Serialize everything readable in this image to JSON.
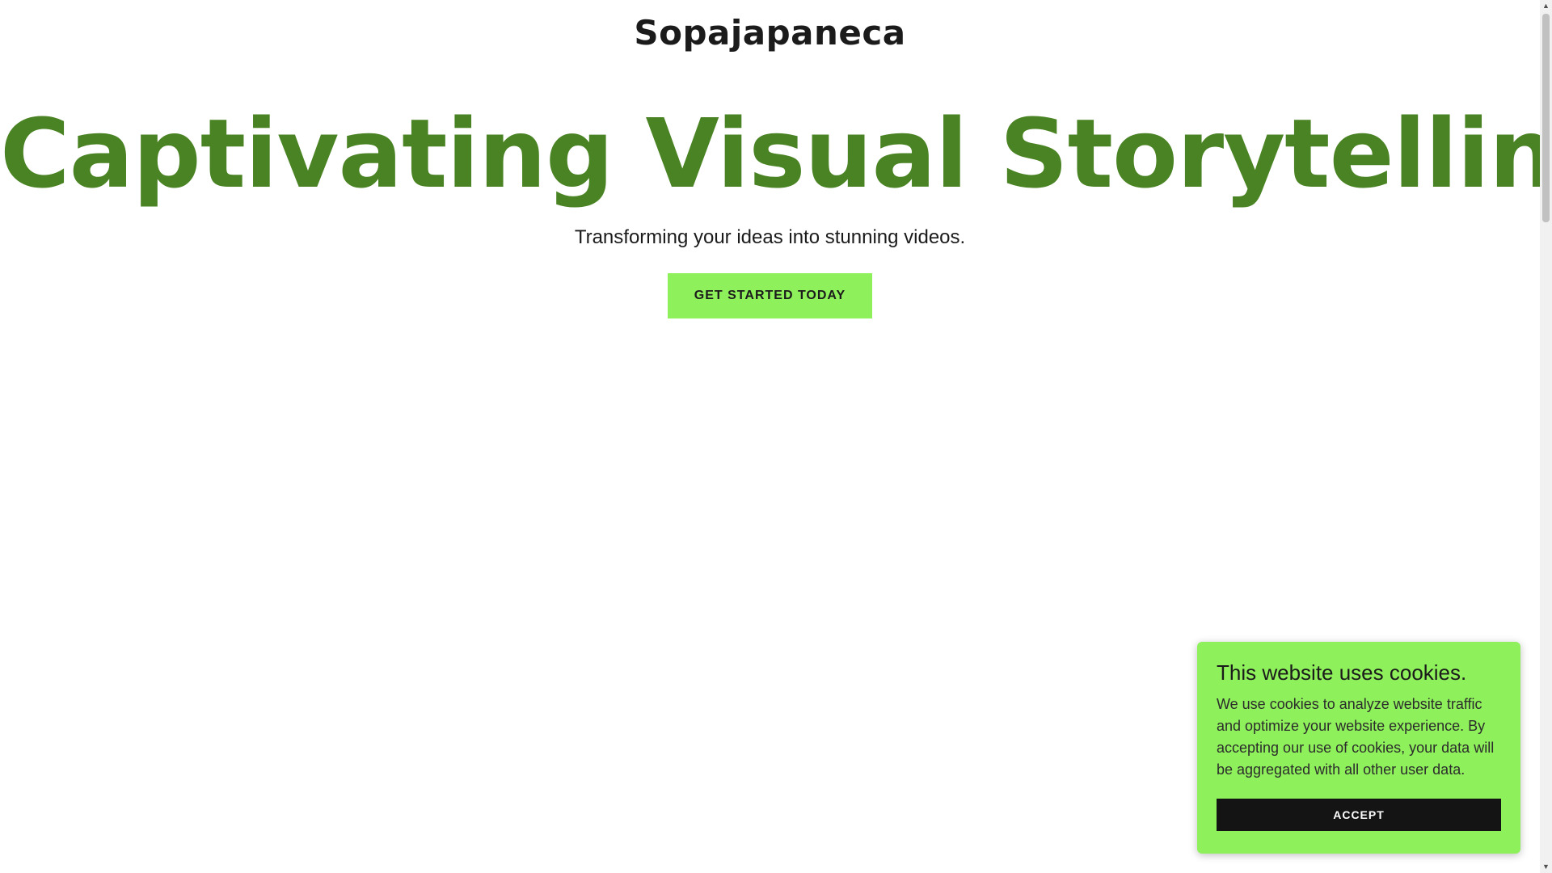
{
  "header": {
    "brand": "Sopajapaneca"
  },
  "hero": {
    "title": "Captivating Visual Storytelling",
    "subtitle": "Transforming your ideas into stunning videos.",
    "cta_label": "GET STARTED TODAY"
  },
  "cookie_banner": {
    "title": "This website uses cookies.",
    "text": "We use cookies to analyze website traffic and optimize your website experience. By accepting our use of cookies, your data will be aggregated with all other user data.",
    "accept_label": "ACCEPT"
  },
  "scrollbar": {
    "up_icon": "▲",
    "down_icon": "▼"
  },
  "colors": {
    "accent": "#8ef05b",
    "title": "#4a8323",
    "text": "#1b1b1b",
    "button_dark": "#141414"
  }
}
